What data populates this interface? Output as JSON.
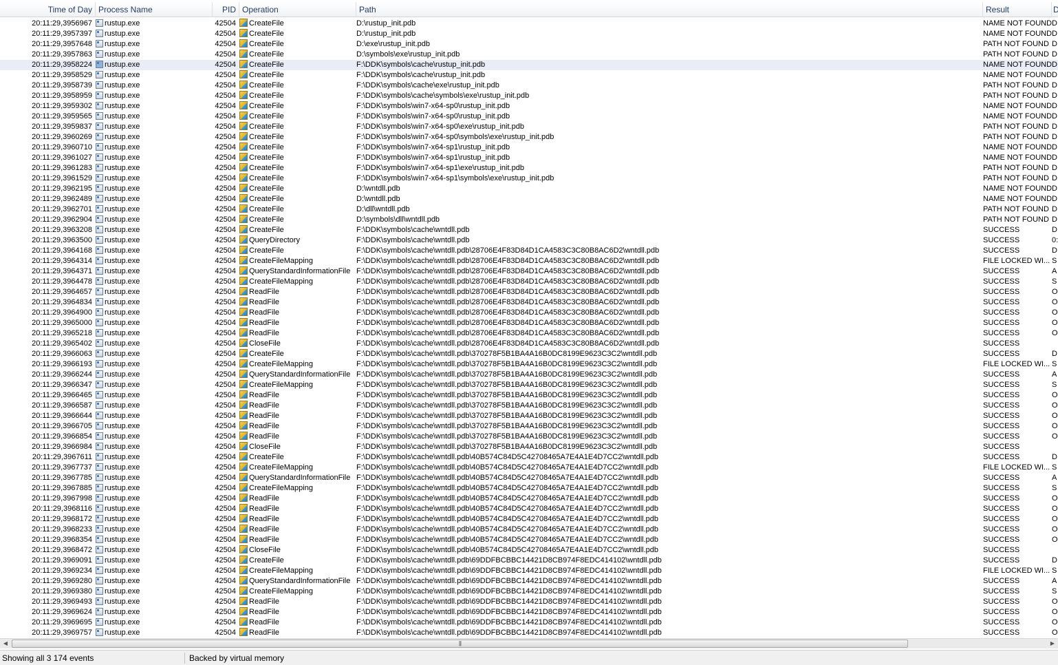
{
  "columns": {
    "time": "Time of Day",
    "process": "Process Name",
    "pid": "PID",
    "operation": "Operation",
    "path": "Path",
    "result": "Result",
    "detail": "D"
  },
  "rows": [
    {
      "time": "20:11:29,3956967",
      "process": "rustup.exe",
      "pid": "42504",
      "op": "CreateFile",
      "path": "D:\\rustup_init.pdb",
      "result": "NAME NOT FOUND",
      "detail": "D"
    },
    {
      "time": "20:11:29,3957397",
      "process": "rustup.exe",
      "pid": "42504",
      "op": "CreateFile",
      "path": "D:\\rustup_init.pdb",
      "result": "NAME NOT FOUND",
      "detail": "D"
    },
    {
      "time": "20:11:29,3957648",
      "process": "rustup.exe",
      "pid": "42504",
      "op": "CreateFile",
      "path": "D:\\exe\\rustup_init.pdb",
      "result": "PATH NOT FOUND",
      "detail": "D"
    },
    {
      "time": "20:11:29,3957863",
      "process": "rustup.exe",
      "pid": "42504",
      "op": "CreateFile",
      "path": "D:\\symbols\\exe\\rustup_init.pdb",
      "result": "PATH NOT FOUND",
      "detail": "D"
    },
    {
      "time": "20:11:29,3958224",
      "process": "rustup.exe",
      "pid": "42504",
      "op": "CreateFile",
      "path": "F:\\DDK\\symbols\\cache\\rustup_init.pdb",
      "result": "NAME NOT FOUND",
      "detail": "D",
      "selected": true
    },
    {
      "time": "20:11:29,3958529",
      "process": "rustup.exe",
      "pid": "42504",
      "op": "CreateFile",
      "path": "F:\\DDK\\symbols\\cache\\rustup_init.pdb",
      "result": "NAME NOT FOUND",
      "detail": "D"
    },
    {
      "time": "20:11:29,3958739",
      "process": "rustup.exe",
      "pid": "42504",
      "op": "CreateFile",
      "path": "F:\\DDK\\symbols\\cache\\exe\\rustup_init.pdb",
      "result": "PATH NOT FOUND",
      "detail": "D"
    },
    {
      "time": "20:11:29,3958959",
      "process": "rustup.exe",
      "pid": "42504",
      "op": "CreateFile",
      "path": "F:\\DDK\\symbols\\cache\\symbols\\exe\\rustup_init.pdb",
      "result": "PATH NOT FOUND",
      "detail": "D"
    },
    {
      "time": "20:11:29,3959302",
      "process": "rustup.exe",
      "pid": "42504",
      "op": "CreateFile",
      "path": "F:\\DDK\\symbols\\win7-x64-sp0\\rustup_init.pdb",
      "result": "NAME NOT FOUND",
      "detail": "D"
    },
    {
      "time": "20:11:29,3959565",
      "process": "rustup.exe",
      "pid": "42504",
      "op": "CreateFile",
      "path": "F:\\DDK\\symbols\\win7-x64-sp0\\rustup_init.pdb",
      "result": "NAME NOT FOUND",
      "detail": "D"
    },
    {
      "time": "20:11:29,3959837",
      "process": "rustup.exe",
      "pid": "42504",
      "op": "CreateFile",
      "path": "F:\\DDK\\symbols\\win7-x64-sp0\\exe\\rustup_init.pdb",
      "result": "PATH NOT FOUND",
      "detail": "D"
    },
    {
      "time": "20:11:29,3960269",
      "process": "rustup.exe",
      "pid": "42504",
      "op": "CreateFile",
      "path": "F:\\DDK\\symbols\\win7-x64-sp0\\symbols\\exe\\rustup_init.pdb",
      "result": "PATH NOT FOUND",
      "detail": "D"
    },
    {
      "time": "20:11:29,3960710",
      "process": "rustup.exe",
      "pid": "42504",
      "op": "CreateFile",
      "path": "F:\\DDK\\symbols\\win7-x64-sp1\\rustup_init.pdb",
      "result": "NAME NOT FOUND",
      "detail": "D"
    },
    {
      "time": "20:11:29,3961027",
      "process": "rustup.exe",
      "pid": "42504",
      "op": "CreateFile",
      "path": "F:\\DDK\\symbols\\win7-x64-sp1\\rustup_init.pdb",
      "result": "NAME NOT FOUND",
      "detail": "D"
    },
    {
      "time": "20:11:29,3961283",
      "process": "rustup.exe",
      "pid": "42504",
      "op": "CreateFile",
      "path": "F:\\DDK\\symbols\\win7-x64-sp1\\exe\\rustup_init.pdb",
      "result": "PATH NOT FOUND",
      "detail": "D"
    },
    {
      "time": "20:11:29,3961529",
      "process": "rustup.exe",
      "pid": "42504",
      "op": "CreateFile",
      "path": "F:\\DDK\\symbols\\win7-x64-sp1\\symbols\\exe\\rustup_init.pdb",
      "result": "PATH NOT FOUND",
      "detail": "D"
    },
    {
      "time": "20:11:29,3962195",
      "process": "rustup.exe",
      "pid": "42504",
      "op": "CreateFile",
      "path": "D:\\wntdll.pdb",
      "result": "NAME NOT FOUND",
      "detail": "D"
    },
    {
      "time": "20:11:29,3962489",
      "process": "rustup.exe",
      "pid": "42504",
      "op": "CreateFile",
      "path": "D:\\wntdll.pdb",
      "result": "NAME NOT FOUND",
      "detail": "D"
    },
    {
      "time": "20:11:29,3962701",
      "process": "rustup.exe",
      "pid": "42504",
      "op": "CreateFile",
      "path": "D:\\dll\\wntdll.pdb",
      "result": "PATH NOT FOUND",
      "detail": "D"
    },
    {
      "time": "20:11:29,3962904",
      "process": "rustup.exe",
      "pid": "42504",
      "op": "CreateFile",
      "path": "D:\\symbols\\dll\\wntdll.pdb",
      "result": "PATH NOT FOUND",
      "detail": "D"
    },
    {
      "time": "20:11:29,3963208",
      "process": "rustup.exe",
      "pid": "42504",
      "op": "CreateFile",
      "path": "F:\\DDK\\symbols\\cache\\wntdll.pdb",
      "result": "SUCCESS",
      "detail": "D"
    },
    {
      "time": "20:11:29,3963500",
      "process": "rustup.exe",
      "pid": "42504",
      "op": "QueryDirectory",
      "path": "F:\\DDK\\symbols\\cache\\wntdll.pdb",
      "result": "SUCCESS",
      "detail": "0:"
    },
    {
      "time": "20:11:29,3964168",
      "process": "rustup.exe",
      "pid": "42504",
      "op": "CreateFile",
      "path": "F:\\DDK\\symbols\\cache\\wntdll.pdb\\28706E4F83D84D1CA4583C3C80B8AC6D2\\wntdll.pdb",
      "result": "SUCCESS",
      "detail": "D"
    },
    {
      "time": "20:11:29,3964314",
      "process": "rustup.exe",
      "pid": "42504",
      "op": "CreateFileMapping",
      "path": "F:\\DDK\\symbols\\cache\\wntdll.pdb\\28706E4F83D84D1CA4583C3C80B8AC6D2\\wntdll.pdb",
      "result": "FILE LOCKED WI...",
      "detail": "S"
    },
    {
      "time": "20:11:29,3964371",
      "process": "rustup.exe",
      "pid": "42504",
      "op": "QueryStandardInformationFile",
      "path": "F:\\DDK\\symbols\\cache\\wntdll.pdb\\28706E4F83D84D1CA4583C3C80B8AC6D2\\wntdll.pdb",
      "result": "SUCCESS",
      "detail": "A"
    },
    {
      "time": "20:11:29,3964478",
      "process": "rustup.exe",
      "pid": "42504",
      "op": "CreateFileMapping",
      "path": "F:\\DDK\\symbols\\cache\\wntdll.pdb\\28706E4F83D84D1CA4583C3C80B8AC6D2\\wntdll.pdb",
      "result": "SUCCESS",
      "detail": "S"
    },
    {
      "time": "20:11:29,3964657",
      "process": "rustup.exe",
      "pid": "42504",
      "op": "ReadFile",
      "path": "F:\\DDK\\symbols\\cache\\wntdll.pdb\\28706E4F83D84D1CA4583C3C80B8AC6D2\\wntdll.pdb",
      "result": "SUCCESS",
      "detail": "O"
    },
    {
      "time": "20:11:29,3964834",
      "process": "rustup.exe",
      "pid": "42504",
      "op": "ReadFile",
      "path": "F:\\DDK\\symbols\\cache\\wntdll.pdb\\28706E4F83D84D1CA4583C3C80B8AC6D2\\wntdll.pdb",
      "result": "SUCCESS",
      "detail": "O"
    },
    {
      "time": "20:11:29,3964900",
      "process": "rustup.exe",
      "pid": "42504",
      "op": "ReadFile",
      "path": "F:\\DDK\\symbols\\cache\\wntdll.pdb\\28706E4F83D84D1CA4583C3C80B8AC6D2\\wntdll.pdb",
      "result": "SUCCESS",
      "detail": "O"
    },
    {
      "time": "20:11:29,3965000",
      "process": "rustup.exe",
      "pid": "42504",
      "op": "ReadFile",
      "path": "F:\\DDK\\symbols\\cache\\wntdll.pdb\\28706E4F83D84D1CA4583C3C80B8AC6D2\\wntdll.pdb",
      "result": "SUCCESS",
      "detail": "O"
    },
    {
      "time": "20:11:29,3965218",
      "process": "rustup.exe",
      "pid": "42504",
      "op": "ReadFile",
      "path": "F:\\DDK\\symbols\\cache\\wntdll.pdb\\28706E4F83D84D1CA4583C3C80B8AC6D2\\wntdll.pdb",
      "result": "SUCCESS",
      "detail": "O"
    },
    {
      "time": "20:11:29,3965402",
      "process": "rustup.exe",
      "pid": "42504",
      "op": "CloseFile",
      "path": "F:\\DDK\\symbols\\cache\\wntdll.pdb\\28706E4F83D84D1CA4583C3C80B8AC6D2\\wntdll.pdb",
      "result": "SUCCESS",
      "detail": ""
    },
    {
      "time": "20:11:29,3966063",
      "process": "rustup.exe",
      "pid": "42504",
      "op": "CreateFile",
      "path": "F:\\DDK\\symbols\\cache\\wntdll.pdb\\370278F5B1BA4A16B0DC8199E9623C3C2\\wntdll.pdb",
      "result": "SUCCESS",
      "detail": "D"
    },
    {
      "time": "20:11:29,3966193",
      "process": "rustup.exe",
      "pid": "42504",
      "op": "CreateFileMapping",
      "path": "F:\\DDK\\symbols\\cache\\wntdll.pdb\\370278F5B1BA4A16B0DC8199E9623C3C2\\wntdll.pdb",
      "result": "FILE LOCKED WI...",
      "detail": "S"
    },
    {
      "time": "20:11:29,3966244",
      "process": "rustup.exe",
      "pid": "42504",
      "op": "QueryStandardInformationFile",
      "path": "F:\\DDK\\symbols\\cache\\wntdll.pdb\\370278F5B1BA4A16B0DC8199E9623C3C2\\wntdll.pdb",
      "result": "SUCCESS",
      "detail": "A"
    },
    {
      "time": "20:11:29,3966347",
      "process": "rustup.exe",
      "pid": "42504",
      "op": "CreateFileMapping",
      "path": "F:\\DDK\\symbols\\cache\\wntdll.pdb\\370278F5B1BA4A16B0DC8199E9623C3C2\\wntdll.pdb",
      "result": "SUCCESS",
      "detail": "S"
    },
    {
      "time": "20:11:29,3966465",
      "process": "rustup.exe",
      "pid": "42504",
      "op": "ReadFile",
      "path": "F:\\DDK\\symbols\\cache\\wntdll.pdb\\370278F5B1BA4A16B0DC8199E9623C3C2\\wntdll.pdb",
      "result": "SUCCESS",
      "detail": "O"
    },
    {
      "time": "20:11:29,3966587",
      "process": "rustup.exe",
      "pid": "42504",
      "op": "ReadFile",
      "path": "F:\\DDK\\symbols\\cache\\wntdll.pdb\\370278F5B1BA4A16B0DC8199E9623C3C2\\wntdll.pdb",
      "result": "SUCCESS",
      "detail": "O"
    },
    {
      "time": "20:11:29,3966644",
      "process": "rustup.exe",
      "pid": "42504",
      "op": "ReadFile",
      "path": "F:\\DDK\\symbols\\cache\\wntdll.pdb\\370278F5B1BA4A16B0DC8199E9623C3C2\\wntdll.pdb",
      "result": "SUCCESS",
      "detail": "O"
    },
    {
      "time": "20:11:29,3966705",
      "process": "rustup.exe",
      "pid": "42504",
      "op": "ReadFile",
      "path": "F:\\DDK\\symbols\\cache\\wntdll.pdb\\370278F5B1BA4A16B0DC8199E9623C3C2\\wntdll.pdb",
      "result": "SUCCESS",
      "detail": "O"
    },
    {
      "time": "20:11:29,3966854",
      "process": "rustup.exe",
      "pid": "42504",
      "op": "ReadFile",
      "path": "F:\\DDK\\symbols\\cache\\wntdll.pdb\\370278F5B1BA4A16B0DC8199E9623C3C2\\wntdll.pdb",
      "result": "SUCCESS",
      "detail": "O"
    },
    {
      "time": "20:11:29,3966984",
      "process": "rustup.exe",
      "pid": "42504",
      "op": "CloseFile",
      "path": "F:\\DDK\\symbols\\cache\\wntdll.pdb\\370278F5B1BA4A16B0DC8199E9623C3C2\\wntdll.pdb",
      "result": "SUCCESS",
      "detail": ""
    },
    {
      "time": "20:11:29,3967611",
      "process": "rustup.exe",
      "pid": "42504",
      "op": "CreateFile",
      "path": "F:\\DDK\\symbols\\cache\\wntdll.pdb\\40B574C84D5C42708465A7E4A1E4D7CC2\\wntdll.pdb",
      "result": "SUCCESS",
      "detail": "D"
    },
    {
      "time": "20:11:29,3967737",
      "process": "rustup.exe",
      "pid": "42504",
      "op": "CreateFileMapping",
      "path": "F:\\DDK\\symbols\\cache\\wntdll.pdb\\40B574C84D5C42708465A7E4A1E4D7CC2\\wntdll.pdb",
      "result": "FILE LOCKED WI...",
      "detail": "S"
    },
    {
      "time": "20:11:29,3967785",
      "process": "rustup.exe",
      "pid": "42504",
      "op": "QueryStandardInformationFile",
      "path": "F:\\DDK\\symbols\\cache\\wntdll.pdb\\40B574C84D5C42708465A7E4A1E4D7CC2\\wntdll.pdb",
      "result": "SUCCESS",
      "detail": "A"
    },
    {
      "time": "20:11:29,3967885",
      "process": "rustup.exe",
      "pid": "42504",
      "op": "CreateFileMapping",
      "path": "F:\\DDK\\symbols\\cache\\wntdll.pdb\\40B574C84D5C42708465A7E4A1E4D7CC2\\wntdll.pdb",
      "result": "SUCCESS",
      "detail": "S"
    },
    {
      "time": "20:11:29,3967998",
      "process": "rustup.exe",
      "pid": "42504",
      "op": "ReadFile",
      "path": "F:\\DDK\\symbols\\cache\\wntdll.pdb\\40B574C84D5C42708465A7E4A1E4D7CC2\\wntdll.pdb",
      "result": "SUCCESS",
      "detail": "O"
    },
    {
      "time": "20:11:29,3968116",
      "process": "rustup.exe",
      "pid": "42504",
      "op": "ReadFile",
      "path": "F:\\DDK\\symbols\\cache\\wntdll.pdb\\40B574C84D5C42708465A7E4A1E4D7CC2\\wntdll.pdb",
      "result": "SUCCESS",
      "detail": "O"
    },
    {
      "time": "20:11:29,3968172",
      "process": "rustup.exe",
      "pid": "42504",
      "op": "ReadFile",
      "path": "F:\\DDK\\symbols\\cache\\wntdll.pdb\\40B574C84D5C42708465A7E4A1E4D7CC2\\wntdll.pdb",
      "result": "SUCCESS",
      "detail": "O"
    },
    {
      "time": "20:11:29,3968233",
      "process": "rustup.exe",
      "pid": "42504",
      "op": "ReadFile",
      "path": "F:\\DDK\\symbols\\cache\\wntdll.pdb\\40B574C84D5C42708465A7E4A1E4D7CC2\\wntdll.pdb",
      "result": "SUCCESS",
      "detail": "O"
    },
    {
      "time": "20:11:29,3968354",
      "process": "rustup.exe",
      "pid": "42504",
      "op": "ReadFile",
      "path": "F:\\DDK\\symbols\\cache\\wntdll.pdb\\40B574C84D5C42708465A7E4A1E4D7CC2\\wntdll.pdb",
      "result": "SUCCESS",
      "detail": "O"
    },
    {
      "time": "20:11:29,3968472",
      "process": "rustup.exe",
      "pid": "42504",
      "op": "CloseFile",
      "path": "F:\\DDK\\symbols\\cache\\wntdll.pdb\\40B574C84D5C42708465A7E4A1E4D7CC2\\wntdll.pdb",
      "result": "SUCCESS",
      "detail": ""
    },
    {
      "time": "20:11:29,3969091",
      "process": "rustup.exe",
      "pid": "42504",
      "op": "CreateFile",
      "path": "F:\\DDK\\symbols\\cache\\wntdll.pdb\\69DDFBCBBC14421D8CB974F8EDC414102\\wntdll.pdb",
      "result": "SUCCESS",
      "detail": "D"
    },
    {
      "time": "20:11:29,3969234",
      "process": "rustup.exe",
      "pid": "42504",
      "op": "CreateFileMapping",
      "path": "F:\\DDK\\symbols\\cache\\wntdll.pdb\\69DDFBCBBC14421D8CB974F8EDC414102\\wntdll.pdb",
      "result": "FILE LOCKED WI...",
      "detail": "S"
    },
    {
      "time": "20:11:29,3969280",
      "process": "rustup.exe",
      "pid": "42504",
      "op": "QueryStandardInformationFile",
      "path": "F:\\DDK\\symbols\\cache\\wntdll.pdb\\69DDFBCBBC14421D8CB974F8EDC414102\\wntdll.pdb",
      "result": "SUCCESS",
      "detail": "A"
    },
    {
      "time": "20:11:29,3969380",
      "process": "rustup.exe",
      "pid": "42504",
      "op": "CreateFileMapping",
      "path": "F:\\DDK\\symbols\\cache\\wntdll.pdb\\69DDFBCBBC14421D8CB974F8EDC414102\\wntdll.pdb",
      "result": "SUCCESS",
      "detail": "S"
    },
    {
      "time": "20:11:29,3969493",
      "process": "rustup.exe",
      "pid": "42504",
      "op": "ReadFile",
      "path": "F:\\DDK\\symbols\\cache\\wntdll.pdb\\69DDFBCBBC14421D8CB974F8EDC414102\\wntdll.pdb",
      "result": "SUCCESS",
      "detail": "O"
    },
    {
      "time": "20:11:29,3969624",
      "process": "rustup.exe",
      "pid": "42504",
      "op": "ReadFile",
      "path": "F:\\DDK\\symbols\\cache\\wntdll.pdb\\69DDFBCBBC14421D8CB974F8EDC414102\\wntdll.pdb",
      "result": "SUCCESS",
      "detail": "O"
    },
    {
      "time": "20:11:29,3969695",
      "process": "rustup.exe",
      "pid": "42504",
      "op": "ReadFile",
      "path": "F:\\DDK\\symbols\\cache\\wntdll.pdb\\69DDFBCBBC14421D8CB974F8EDC414102\\wntdll.pdb",
      "result": "SUCCESS",
      "detail": "O"
    },
    {
      "time": "20:11:29,3969757",
      "process": "rustup.exe",
      "pid": "42504",
      "op": "ReadFile",
      "path": "F:\\DDK\\symbols\\cache\\wntdll.pdb\\69DDFBCBBC14421D8CB974F8EDC414102\\wntdll.pdb",
      "result": "SUCCESS",
      "detail": "O"
    }
  ],
  "status": {
    "events": "Showing all 3 174 events",
    "backing": "Backed by virtual memory"
  },
  "icons": {
    "process": "process-icon",
    "operation": "filesystem-icon"
  }
}
